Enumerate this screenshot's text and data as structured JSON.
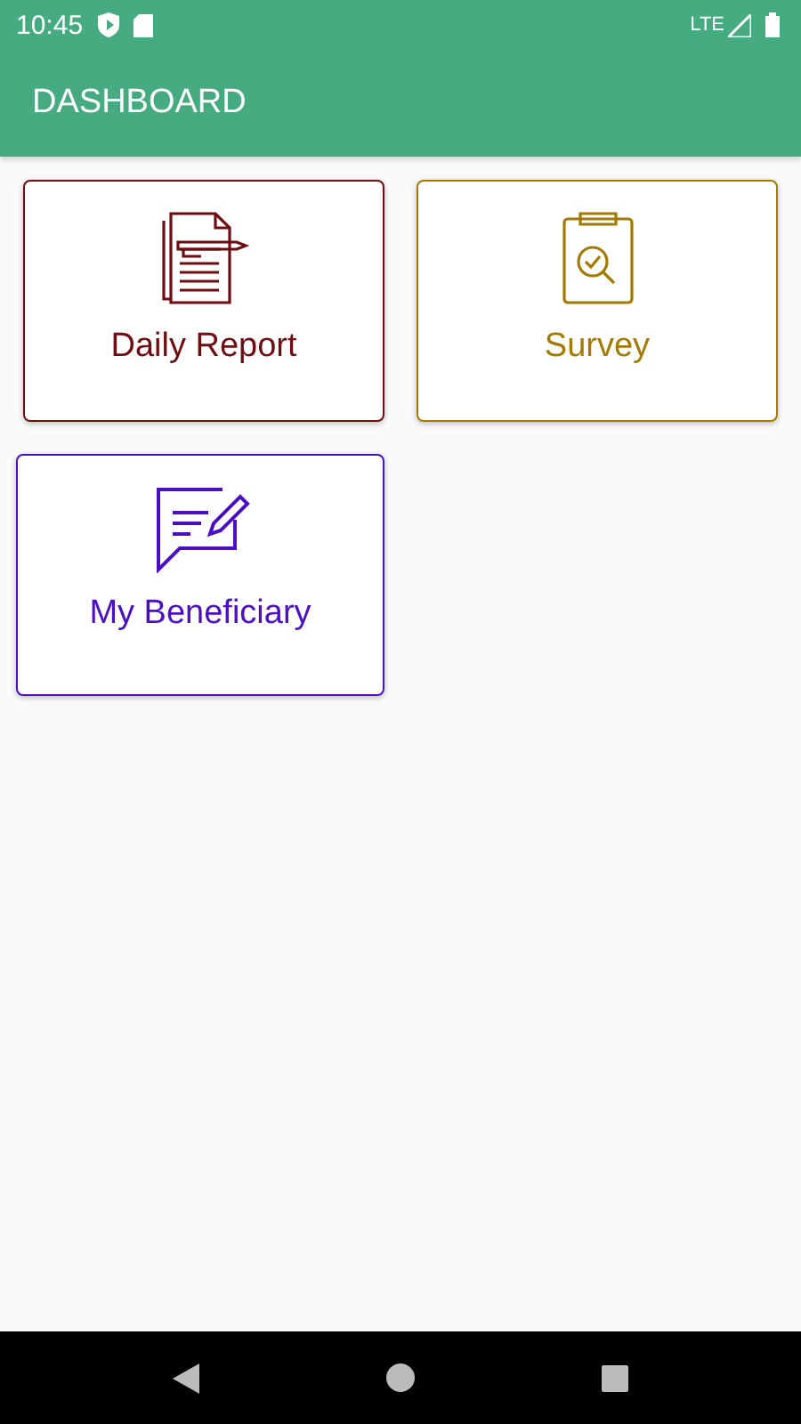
{
  "status_bar": {
    "time": "10:45",
    "network": "LTE"
  },
  "app_bar": {
    "title": "DASHBOARD"
  },
  "tiles": [
    {
      "label": "Daily Report",
      "kind": "report",
      "color": "#6e0e12"
    },
    {
      "label": "Survey",
      "kind": "survey",
      "color": "#a37b00"
    },
    {
      "label": "My Beneficiary",
      "kind": "message",
      "color": "#4b10c4"
    }
  ]
}
